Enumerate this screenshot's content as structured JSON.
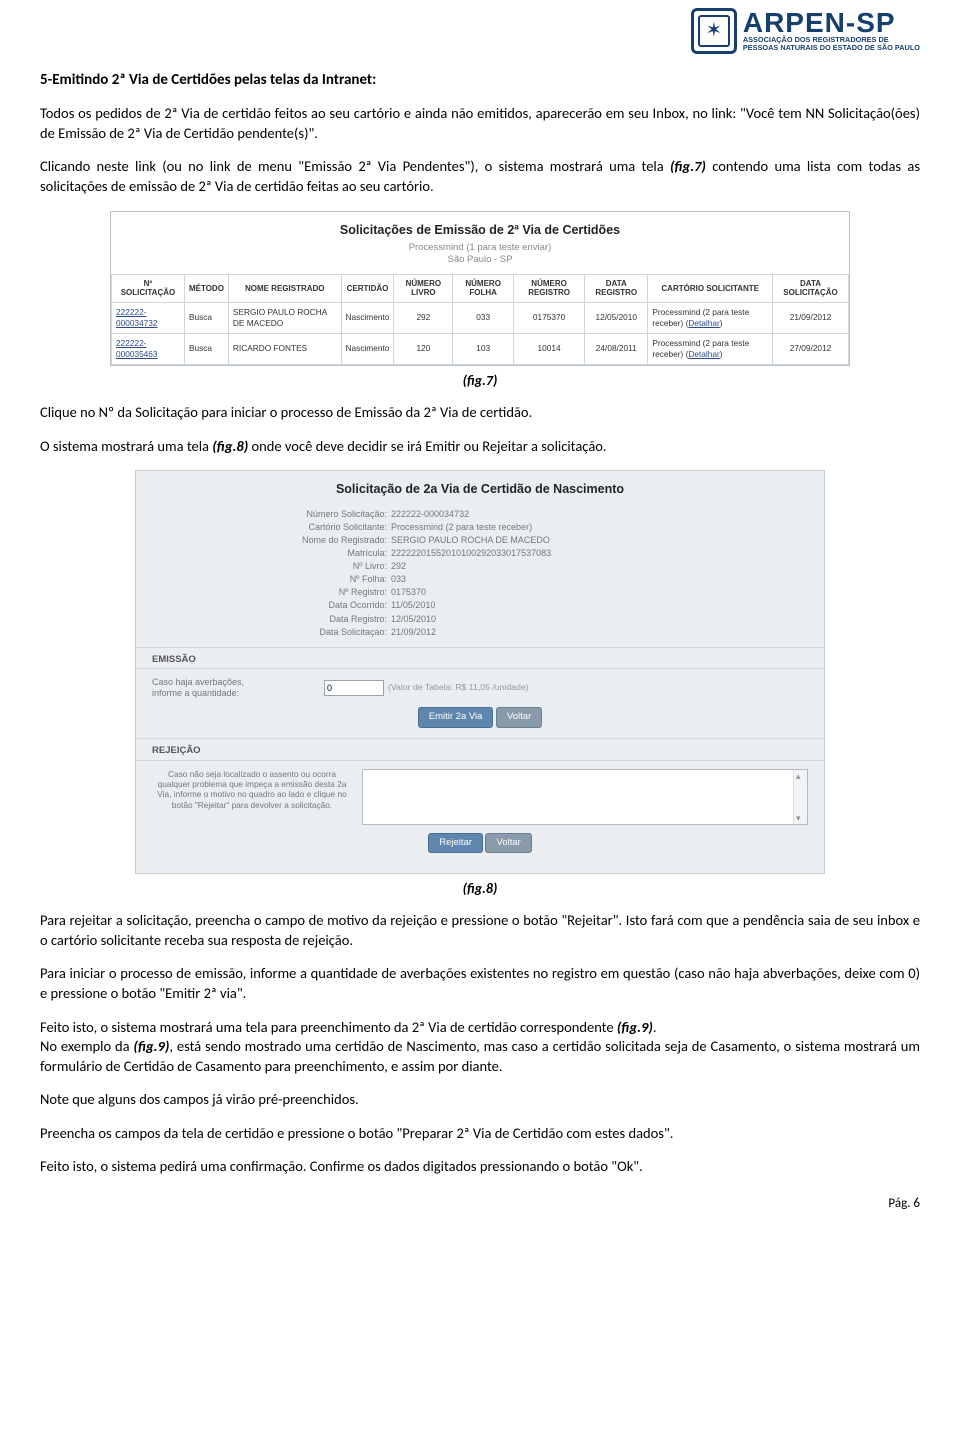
{
  "logo": {
    "main": "ARPEN-SP",
    "sub1": "ASSOCIAÇÃO DOS REGISTRADORES DE",
    "sub2": "PESSOAS NATURAIS DO ESTADO DE SÃO PAULO"
  },
  "title": "5-Emitindo 2ª Via de Certidões pelas telas da Intranet:",
  "p1": "Todos os pedidos de 2ª Via de certidão feitos ao seu cartório e ainda não emitidos, aparecerão em seu Inbox, no link: \"Você tem NN Solicitação(ões) de Emissão de 2ª Via de Certidão pendente(s)\".",
  "p2a": "Clicando neste link (ou no link de menu \"Emissão 2ª Via Pendentes\"), o sistema mostrará uma tela ",
  "p2b": " contendo uma lista com todas as solicitações de emissão de 2ª Via de certidão feitas ao seu cartório.",
  "fig7ref": "(fig.7)",
  "fig7": {
    "title": "Solicitações de Emissão de 2ª Via de Certidões",
    "sub1": "Processmind (1 para teste enviar)",
    "sub2": "São Paulo - SP",
    "headers": [
      "Nº SOLICITAÇÃO",
      "MÉTODO",
      "NOME REGISTRADO",
      "CERTIDÃO",
      "NÚMERO LIVRO",
      "NÚMERO FOLHA",
      "NÚMERO REGISTRO",
      "DATA REGISTRO",
      "CARTÓRIO SOLICITANTE",
      "DATA SOLICITAÇÃO"
    ],
    "rows": [
      {
        "sol": "222222-000034732",
        "met": "Busca",
        "nome": "SERGIO PAULO ROCHA DE MACEDO",
        "cert": "Nascimento",
        "liv": "292",
        "fol": "033",
        "reg": "0175370",
        "dreg": "12/05/2010",
        "cart": "Processmind (2 para teste receber)",
        "det": "Detalhar",
        "dsol": "21/09/2012"
      },
      {
        "sol": "222222-000035463",
        "met": "Busca",
        "nome": "RICARDO FONTES",
        "cert": "Nascimento",
        "liv": "120",
        "fol": "103",
        "reg": "10014",
        "dreg": "24/08/2011",
        "cart": "Processmind (2 para teste receber)",
        "det": "Detalhar",
        "dsol": "27/09/2012"
      }
    ],
    "caption": "(fig.7)"
  },
  "p3": "Clique no Nº da Solicitação para iniciar o processo de Emissão da 2ª Via de certidão.",
  "p4a": "O sistema mostrará uma tela ",
  "p4b": " onde você deve decidir se irá Emitir ou Rejeitar a solicitação.",
  "fig8ref": "(fig.8)",
  "fig8": {
    "title": "Solicitação de 2a Via de Certidão de Nascimento",
    "fields": [
      {
        "l": "Número Solicitação:",
        "v": "222222-000034732"
      },
      {
        "l": "Cartório Solicitante:",
        "v": "Processmind (2 para teste receber)"
      },
      {
        "l": "Nome do Registrado:",
        "v": "SERGIO PAULO ROCHA DE MACEDO"
      },
      {
        "l": "Matrícula:",
        "v": "22222201552010100292033017537083"
      },
      {
        "l": "Nº Livro:",
        "v": "292"
      },
      {
        "l": "Nº Folha:",
        "v": "033"
      },
      {
        "l": "Nº Registro:",
        "v": "0175370"
      },
      {
        "l": "Data Ocorrido:",
        "v": "11/05/2010"
      },
      {
        "l": "Data Registro:",
        "v": "12/05/2010"
      },
      {
        "l": "Data Solicitaçao:",
        "v": "21/09/2012"
      }
    ],
    "emissao": {
      "header": "EMISSÃO",
      "lead1": "Caso haja averbações,",
      "lead2": "informe a quantidade:",
      "value": "0",
      "hint": "(Valor de Tabela: R$ 11,05 /unidade)",
      "btn_emit": "Emitir 2a Via",
      "btn_back": "Voltar"
    },
    "rejeicao": {
      "header": "REJEIÇÃO",
      "text": "Caso não seja localizado o assento ou ocorra qualquer problema que impeça a emissão desta 2a Via, informe o motivo no quadro ao lado e clique no botão \"Rejeitar\" para devolver a solicitação.",
      "btn_reject": "Rejeitar",
      "btn_back": "Voltar"
    },
    "caption": "(fig.8)"
  },
  "p5": "Para rejeitar a solicitação, preencha o campo de motivo da rejeição e pressione o botão \"Rejeitar\". Isto fará com que a pendência saia de seu inbox e o cartório solicitante receba sua resposta de rejeição.",
  "p6": "Para iniciar o processo de emissão, informe a quantidade de averbações existentes no registro em questão (caso não haja abverbações, deixe com 0) e pressione o botão \"Emitir 2ª via\".",
  "p7a": "Feito isto, o sistema mostrará uma tela para preenchimento da 2ª Via de certidão correspondente ",
  "p7b": ".",
  "fig9ref": "(fig.9)",
  "p8a": "No exemplo da ",
  "p8b": ", está sendo mostrado uma certidão de Nascimento, mas caso a certidão solicitada seja de Casamento, o sistema mostrará um formulário de Certidão de Casamento para preenchimento, e assim por diante.",
  "p9": "Note que alguns dos campos já virão pré-preenchidos.",
  "p10": "Preencha os campos da tela de certidão e pressione o botão \"Preparar 2ª Via de Certidão com estes dados\".",
  "p11": "Feito isto, o sistema pedirá uma confirmação. Confirme os dados digitados pressionando o botão \"Ok\".",
  "footer": "Pág. 6"
}
